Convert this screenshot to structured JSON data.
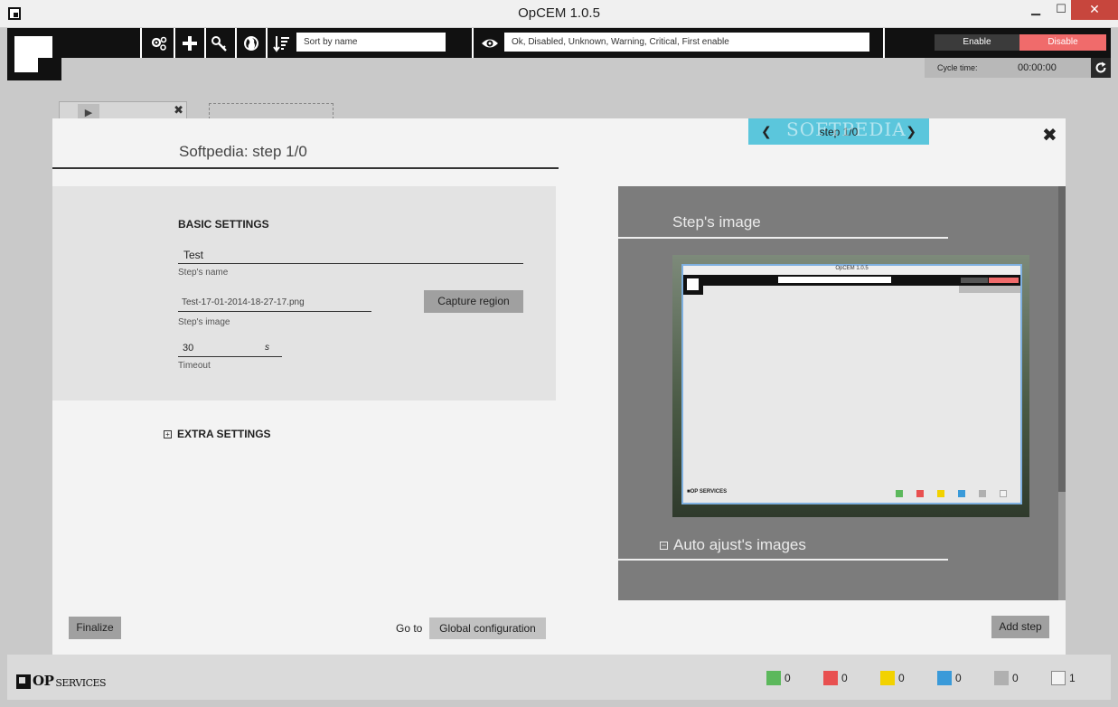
{
  "window": {
    "title": "OpCEM 1.0.5",
    "min_label": "▁",
    "max_label": "☐",
    "close_label": "✕"
  },
  "toolbar": {
    "sort_value": "Sort by name",
    "filter_value": "Ok, Disabled, Unknown, Warning, Critical, First enable",
    "enable_label": "Enable",
    "disable_label": "Disable",
    "icons": [
      "settings-icon",
      "add-icon",
      "key-icon",
      "globe-icon",
      "sort-icon",
      "eye-icon"
    ]
  },
  "cycle": {
    "label": "Cycle time:",
    "value": "00:00:00"
  },
  "dialog": {
    "title": "Softpedia: step 1/0",
    "step_nav_label": "step 1/0",
    "watermark": "SOFTPEDIA",
    "basic_settings": {
      "heading": "BASIC SETTINGS",
      "step_name_value": "Test",
      "step_name_label": "Step's name",
      "step_image_value": "Test-17-01-2014-18-27-17.png",
      "step_image_label": "Step's image",
      "capture_label": "Capture region",
      "timeout_value": "30",
      "timeout_unit": "s",
      "timeout_label": "Timeout"
    },
    "extra_settings": {
      "heading": "EXTRA SETTINGS",
      "toggle": "+"
    },
    "right_panel": {
      "image_heading": "Step's image",
      "auto_adjust_heading": "Auto ajust's images",
      "auto_toggle": "−",
      "thumb_title": "OpCEM 1.0.5"
    },
    "finalize_label": "Finalize",
    "goto_label": "Go to",
    "global_config_label": "Global configuration",
    "add_step_label": "Add step"
  },
  "footer": {
    "logo_text": "OP",
    "logo_sub": "SERVICES",
    "statuses": [
      {
        "name": "ok",
        "color": "#5cb85c",
        "count": "0"
      },
      {
        "name": "critical",
        "color": "#e85050",
        "count": "0"
      },
      {
        "name": "warning",
        "color": "#f2d200",
        "count": "0"
      },
      {
        "name": "unknown",
        "color": "#3a9ad9",
        "count": "0"
      },
      {
        "name": "disabled",
        "color": "#b0b0b0",
        "count": "0"
      },
      {
        "name": "first-enable",
        "color": "#f3f3f3",
        "count": "1"
      }
    ]
  }
}
